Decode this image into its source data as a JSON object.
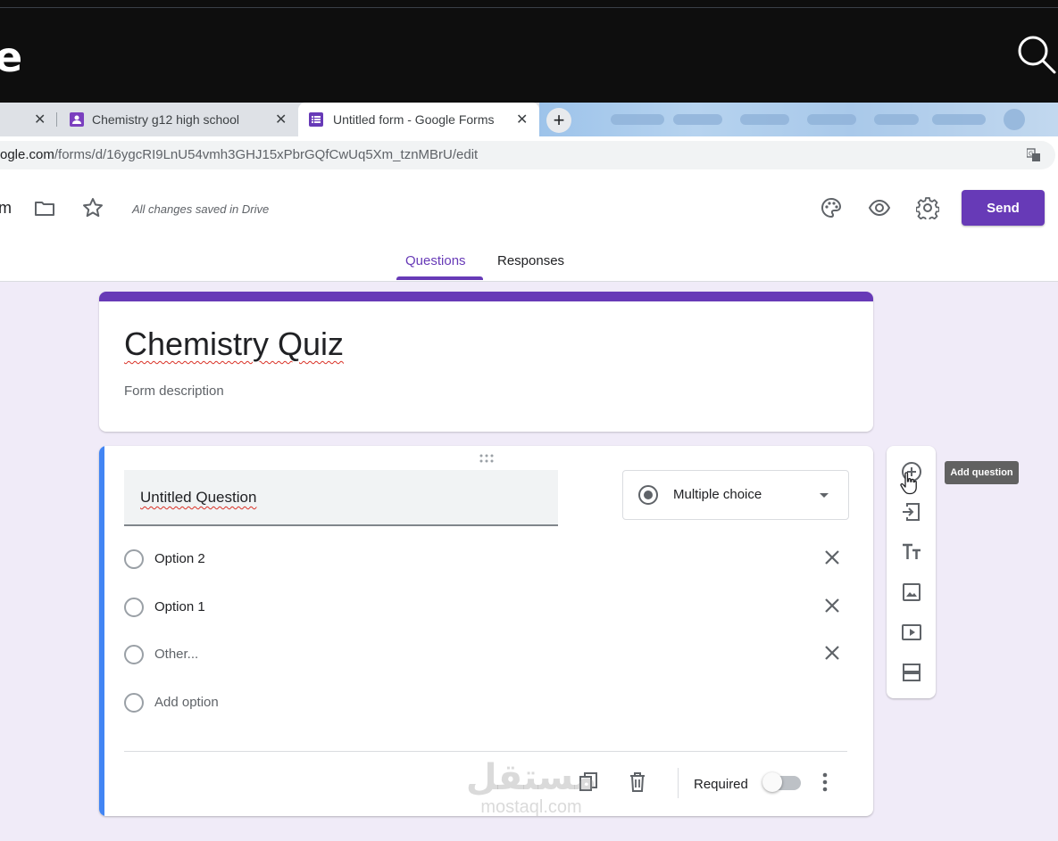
{
  "video_bar": {
    "logo_fragment": "e"
  },
  "browser": {
    "tabs": [
      {
        "title": "Chemistry g12 high school"
      },
      {
        "title": "Untitled form - Google Forms"
      }
    ],
    "new_tab_label": "+",
    "close_label": "✕",
    "url_host": "ogle.com",
    "url_path": "/forms/d/16ygcRI9LnU54vmh3GHJ15xPbrGQfCwUq5Xm_tznMBrU/edit"
  },
  "header": {
    "doc_title_fragment": "m",
    "save_status": "All changes saved in Drive",
    "send_label": "Send",
    "tabs": {
      "questions": "Questions",
      "responses": "Responses"
    }
  },
  "form": {
    "title": "Chemistry Quiz",
    "description_placeholder": "Form description"
  },
  "question": {
    "title": "Untitled Question",
    "type": "Multiple choice",
    "options": [
      "Option 2",
      "Option 1",
      "Other..."
    ],
    "add_option": "Add option",
    "required_label": "Required",
    "required": false
  },
  "tooltip": {
    "add_question": "Add question"
  },
  "watermark": {
    "arabic": "مستقل",
    "latin": "mostaql.com"
  },
  "colors": {
    "accent": "#673ab7",
    "active_bar": "#4285f4",
    "page_bg": "#f0ebf8"
  }
}
